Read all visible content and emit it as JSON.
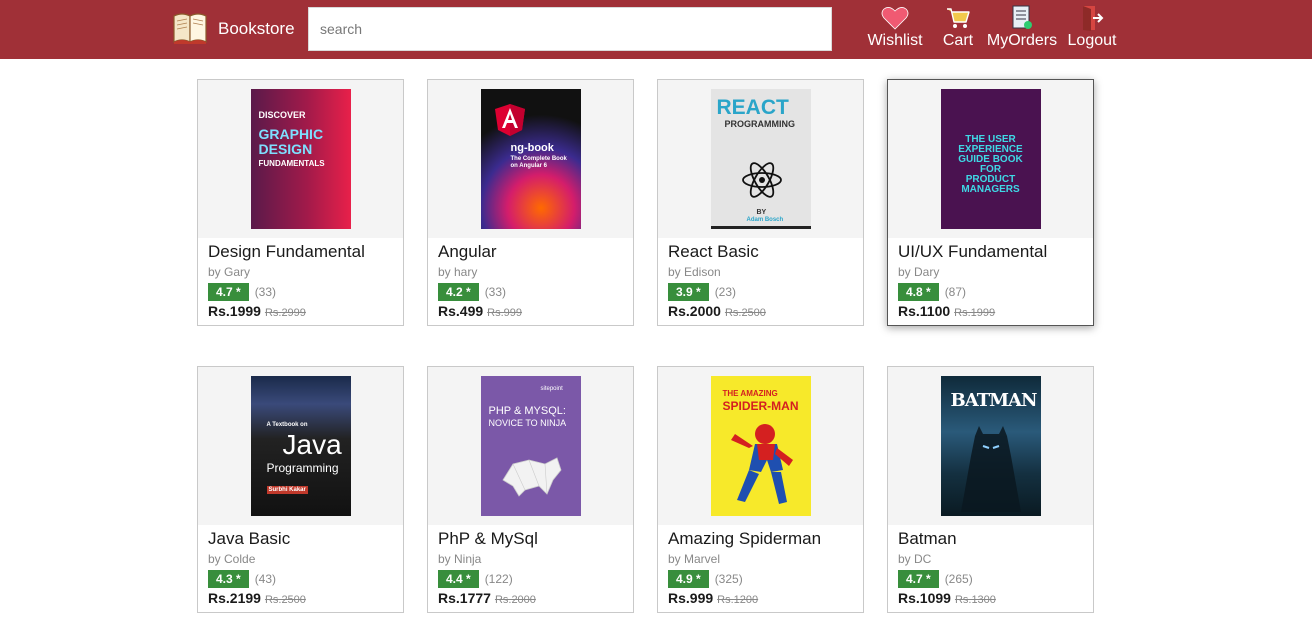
{
  "header": {
    "brand": "Bookstore",
    "search_placeholder": "search",
    "nav": [
      {
        "label": "Wishlist",
        "icon": "heart-icon"
      },
      {
        "label": "Cart",
        "icon": "cart-icon"
      },
      {
        "label": "MyOrders",
        "icon": "orders-icon"
      },
      {
        "label": "Logout",
        "icon": "logout-icon"
      }
    ]
  },
  "colors": {
    "header_bg": "#a03037",
    "rating_bg": "#388e3c",
    "card_img_bg": "#f4f4f4"
  },
  "books": [
    {
      "title": "Design Fundamental",
      "author": "by Gary",
      "rating": "4.7 *",
      "reviews": "(33)",
      "price": "Rs.1999",
      "mrp": "Rs.2999",
      "cover": {
        "lines": [
          "DISCOVER",
          "GRAPHIC",
          "DESIGN",
          "FUNDAMENTALS"
        ]
      }
    },
    {
      "title": "Angular",
      "author": "by hary",
      "rating": "4.2 *",
      "reviews": "(33)",
      "price": "Rs.499",
      "mrp": "Rs.999",
      "cover": {
        "lines": [
          "ng-book",
          "The Complete Book",
          "on Angular 6"
        ]
      }
    },
    {
      "title": "React Basic",
      "author": "by Edison",
      "rating": "3.9 *",
      "reviews": "(23)",
      "price": "Rs.2000",
      "mrp": "Rs.2500",
      "cover": {
        "lines": [
          "REACT",
          "PROGRAMMING",
          "BY",
          "Adam Bosch"
        ]
      }
    },
    {
      "title": "UI/UX Fundamental",
      "author": "by Dary",
      "rating": "4.8 *",
      "reviews": "(87)",
      "price": "Rs.1100",
      "mrp": "Rs.1999",
      "cover": {
        "lines": [
          "THE USER",
          "EXPERIENCE",
          "GUIDE BOOK",
          "FOR",
          "PRODUCT",
          "MANAGERS"
        ]
      }
    },
    {
      "title": "Java Basic",
      "author": "by Colde",
      "rating": "4.3 *",
      "reviews": "(43)",
      "price": "Rs.2199",
      "mrp": "Rs.2500",
      "cover": {
        "lines": [
          "A Textbook on",
          "Java",
          "Programming",
          "Surbhi Kakar"
        ]
      }
    },
    {
      "title": "PhP & MySql",
      "author": "by Ninja",
      "rating": "4.4 *",
      "reviews": "(122)",
      "price": "Rs.1777",
      "mrp": "Rs.2000",
      "cover": {
        "lines": [
          "sitepoint",
          "PHP & MYSQL:",
          "NOVICE TO NINJA"
        ]
      }
    },
    {
      "title": "Amazing Spiderman",
      "author": "by Marvel",
      "rating": "4.9 *",
      "reviews": "(325)",
      "price": "Rs.999",
      "mrp": "Rs.1200",
      "cover": {
        "lines": [
          "THE AMAZING",
          "SPIDER-MAN"
        ]
      }
    },
    {
      "title": "Batman",
      "author": "by DC",
      "rating": "4.7 *",
      "reviews": "(265)",
      "price": "Rs.1099",
      "mrp": "Rs.1300",
      "cover": {
        "lines": [
          "BATMAN"
        ]
      }
    }
  ]
}
